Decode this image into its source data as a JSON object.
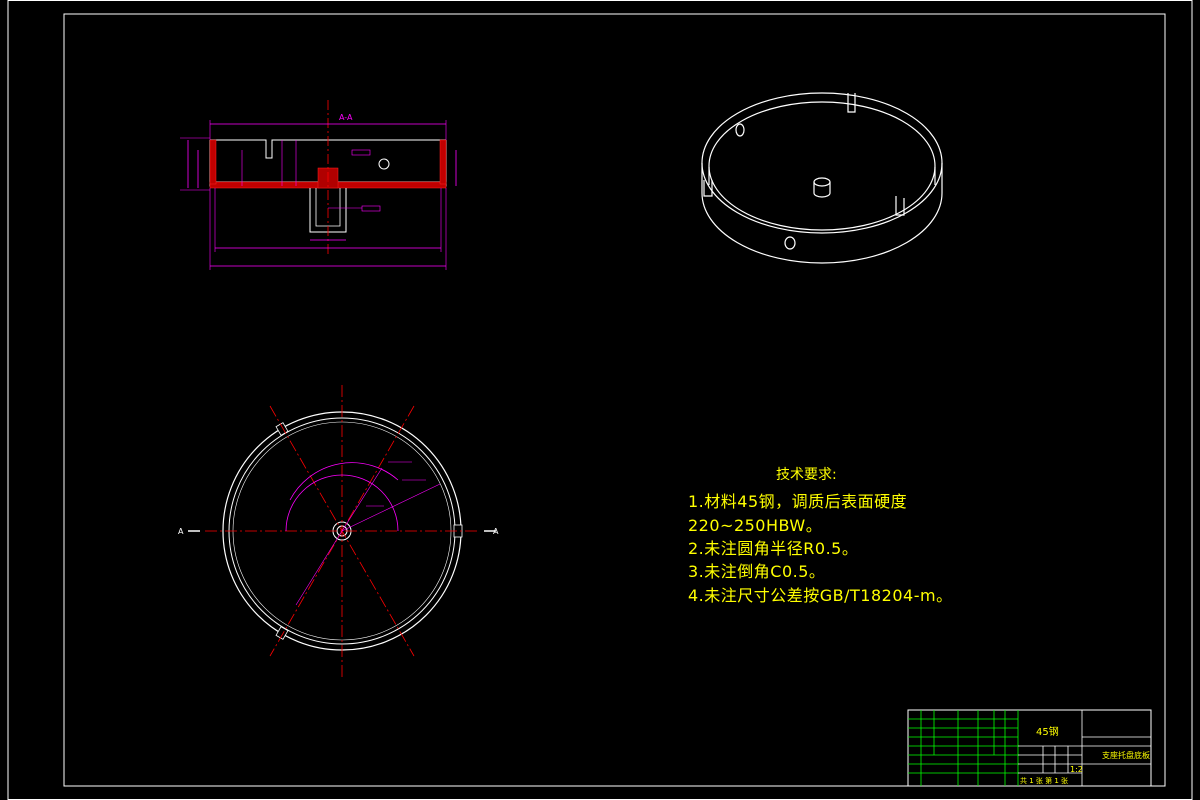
{
  "section_view": {
    "label": "A-A"
  },
  "plan_view": {
    "cut_left": "A",
    "cut_right": "A"
  },
  "technical_requirements": {
    "title": "技术要求:",
    "lines": [
      "1.材料45钢，调质后表面硬度",
      "220~250HBW。",
      "2.未注圆角半径R0.5。",
      "3.未注倒角C0.5。",
      "4.未注尺寸公差按GB/T18204-m。"
    ]
  },
  "title_block": {
    "material": "45钢",
    "drawing_title": "支座托盘底板",
    "drawing_no": "",
    "scale": "1:2",
    "sheet": "共 1 张 第 1 张"
  },
  "colors": {
    "border": "#ffffff",
    "dimension": "#ff00ff",
    "centerline": "#ff0000",
    "text": "#ffff00",
    "grid": "#00ff00",
    "geometry": "#ffffff"
  }
}
